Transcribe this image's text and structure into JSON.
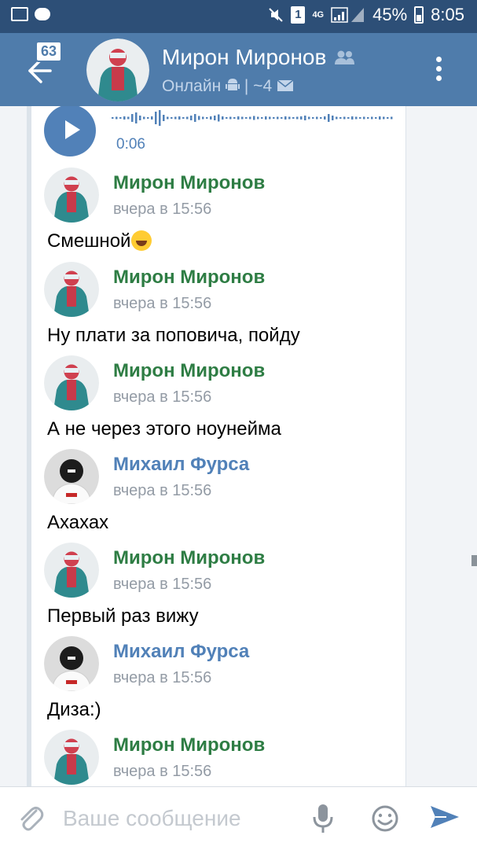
{
  "status_bar": {
    "sim": "1",
    "network": "4G",
    "battery": "45%",
    "time": "8:05",
    "icons": [
      "gallery-icon",
      "chat-icon",
      "mute-icon",
      "signal-icon",
      "battery-icon"
    ]
  },
  "header": {
    "unread_count": "63",
    "name": "Мирон Миронов",
    "status": "Онлайн",
    "status_extra": "| ~4",
    "icons": [
      "back-arrow-icon",
      "friends-icon",
      "android-icon",
      "mail-icon",
      "more-icon"
    ]
  },
  "audio": {
    "duration": "0:06",
    "icons": [
      "play-icon"
    ]
  },
  "messages": [
    {
      "author": "Мирон Миронов",
      "time": "вчера в 15:56",
      "text": "Смешной",
      "emoji": "laughing-emoji-icon",
      "color": "#2e7d44"
    },
    {
      "author": "Мирон Миронов",
      "time": "вчера в 15:56",
      "text": "Ну плати за поповича, пойду",
      "color": "#2e7d44"
    },
    {
      "author": "Мирон Миронов",
      "time": "вчера в 15:56",
      "text": "А не через этого ноунейма",
      "color": "#2e7d44"
    },
    {
      "author": "Михаил Фурса",
      "time": "вчера в 15:56",
      "text": "Ахахах",
      "color": "#5181b8"
    },
    {
      "author": "Мирон Миронов",
      "time": "вчера в 15:56",
      "text": "Первый раз вижу",
      "color": "#2e7d44"
    },
    {
      "author": "Михаил Фурса",
      "time": "вчера в 15:56",
      "text": "Диза:)",
      "color": "#5181b8"
    },
    {
      "author": "Мирон Миронов",
      "time": "вчера в 15:56",
      "text": "",
      "color": "#2e7d44"
    }
  ],
  "input": {
    "placeholder": "Ваше сообщение",
    "icons": [
      "attach-icon",
      "mic-icon",
      "smile-icon",
      "send-icon"
    ]
  },
  "colors": {
    "status_bar": "#2d4f77",
    "header": "#4f7cab",
    "accent": "#5181b8",
    "author_green": "#2e7d44",
    "time_gray": "#939ba5"
  }
}
